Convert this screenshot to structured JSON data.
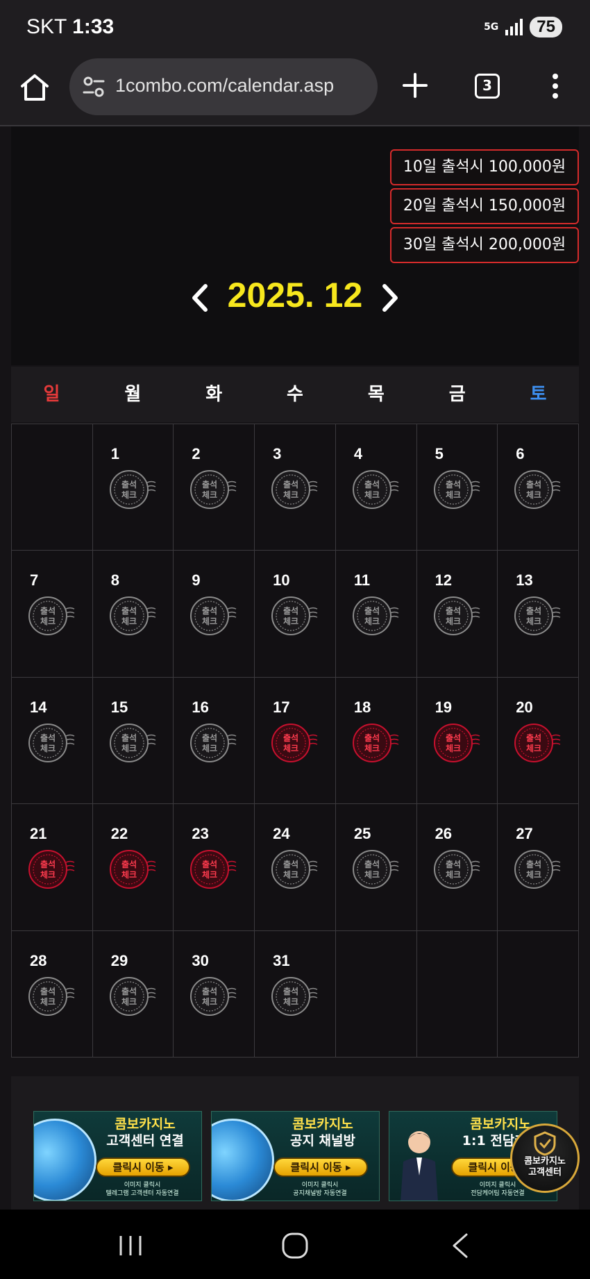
{
  "status": {
    "carrier": "SKT",
    "time": "1:33",
    "network": "5G",
    "battery": "75"
  },
  "browser": {
    "url": "1combo.com/calendar.asp",
    "tab_count": "3"
  },
  "rewards": [
    "10일 출석시 100,000원",
    "20일 출석시 150,000원",
    "30일 출석시 200,000원"
  ],
  "calendar": {
    "month_title": "2025. 12",
    "weekdays": [
      "일",
      "월",
      "화",
      "수",
      "목",
      "금",
      "토"
    ],
    "stamp_text": [
      "출석",
      "체크"
    ],
    "weeks": [
      [
        {
          "day": "",
          "checked": null
        },
        {
          "day": "1",
          "checked": false
        },
        {
          "day": "2",
          "checked": false
        },
        {
          "day": "3",
          "checked": false
        },
        {
          "day": "4",
          "checked": false
        },
        {
          "day": "5",
          "checked": false
        },
        {
          "day": "6",
          "checked": false
        }
      ],
      [
        {
          "day": "7",
          "checked": false
        },
        {
          "day": "8",
          "checked": false
        },
        {
          "day": "9",
          "checked": false
        },
        {
          "day": "10",
          "checked": false
        },
        {
          "day": "11",
          "checked": false
        },
        {
          "day": "12",
          "checked": false
        },
        {
          "day": "13",
          "checked": false
        }
      ],
      [
        {
          "day": "14",
          "checked": false
        },
        {
          "day": "15",
          "checked": false
        },
        {
          "day": "16",
          "checked": false
        },
        {
          "day": "17",
          "checked": true
        },
        {
          "day": "18",
          "checked": true
        },
        {
          "day": "19",
          "checked": true
        },
        {
          "day": "20",
          "checked": true
        }
      ],
      [
        {
          "day": "21",
          "checked": true
        },
        {
          "day": "22",
          "checked": true
        },
        {
          "day": "23",
          "checked": true
        },
        {
          "day": "24",
          "checked": false
        },
        {
          "day": "25",
          "checked": false
        },
        {
          "day": "26",
          "checked": false
        },
        {
          "day": "27",
          "checked": false
        }
      ],
      [
        {
          "day": "28",
          "checked": false
        },
        {
          "day": "29",
          "checked": false
        },
        {
          "day": "30",
          "checked": false
        },
        {
          "day": "31",
          "checked": false
        },
        {
          "day": "",
          "checked": null
        },
        {
          "day": "",
          "checked": null
        },
        {
          "day": "",
          "checked": null
        }
      ]
    ]
  },
  "banners": [
    {
      "line1": "콤보카지노",
      "line2": "고객센터 연결",
      "button": "클릭시 이동 ▸",
      "note1": "이미지 클릭시",
      "note2": "텔레그램 고객센터 자동연결"
    },
    {
      "line1": "콤보카지노",
      "line2": "공지 채널방",
      "button": "클릭시 이동 ▸",
      "note1": "이미지 클릭시",
      "note2": "공지채널방 자동연결"
    },
    {
      "line1": "콤보카지노",
      "line2": "1:1 전담케어",
      "button": "클릭시 이동 ▸",
      "note1": "이미지 클릭시",
      "note2": "전담케어팀 자동연결"
    }
  ],
  "cs_badge": {
    "line1": "콤보카지노",
    "line2": "고객센터"
  },
  "colors": {
    "accent_yellow": "#f7e71d",
    "stamp_red": "#c8102e",
    "stamp_gray": "#8a8a8a",
    "sunday": "#e53a3a",
    "saturday": "#3d8ff0",
    "reward_border": "#d52b2b"
  }
}
